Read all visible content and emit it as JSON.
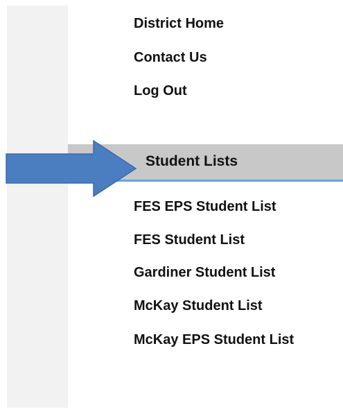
{
  "top_nav": {
    "items": [
      {
        "label": "District Home"
      },
      {
        "label": "Contact Us"
      },
      {
        "label": "Log Out"
      }
    ]
  },
  "section": {
    "title": "Student Lists",
    "highlight_color": "#6aa3d8",
    "header_bg": "#c8c8c8",
    "items": [
      {
        "label": "FES EPS Student List"
      },
      {
        "label": "FES Student List"
      },
      {
        "label": "Gardiner Student List"
      },
      {
        "label": "McKay Student List"
      },
      {
        "label": "McKay EPS Student List"
      }
    ]
  },
  "annotation": {
    "arrow_icon": "right-arrow-icon",
    "arrow_color": "#4a7ec0"
  }
}
